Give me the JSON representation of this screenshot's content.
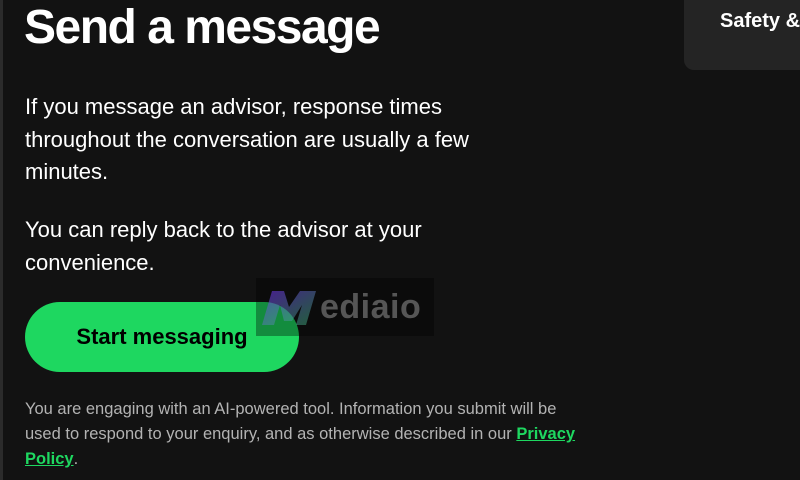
{
  "header": {
    "title": "Send a message"
  },
  "side_card": {
    "label": "Safety &"
  },
  "content": {
    "paragraph_1": "If you message an advisor, response times throughout the conversation are usually a few minutes.",
    "paragraph_2": "You can reply back to the advisor at your convenience.",
    "start_button_label": "Start messaging",
    "disclaimer_prefix": "You are engaging with an AI-powered tool. Information you submit will be used to respond to your enquiry, and as otherwise described in our ",
    "privacy_link_label": "Privacy Policy",
    "disclaimer_suffix": "."
  },
  "watermark": {
    "text": "ediaio",
    "logo": "M"
  },
  "colors": {
    "background": "#121212",
    "accent": "#1ed760",
    "card": "#242424",
    "muted_text": "#b3b3b3"
  }
}
